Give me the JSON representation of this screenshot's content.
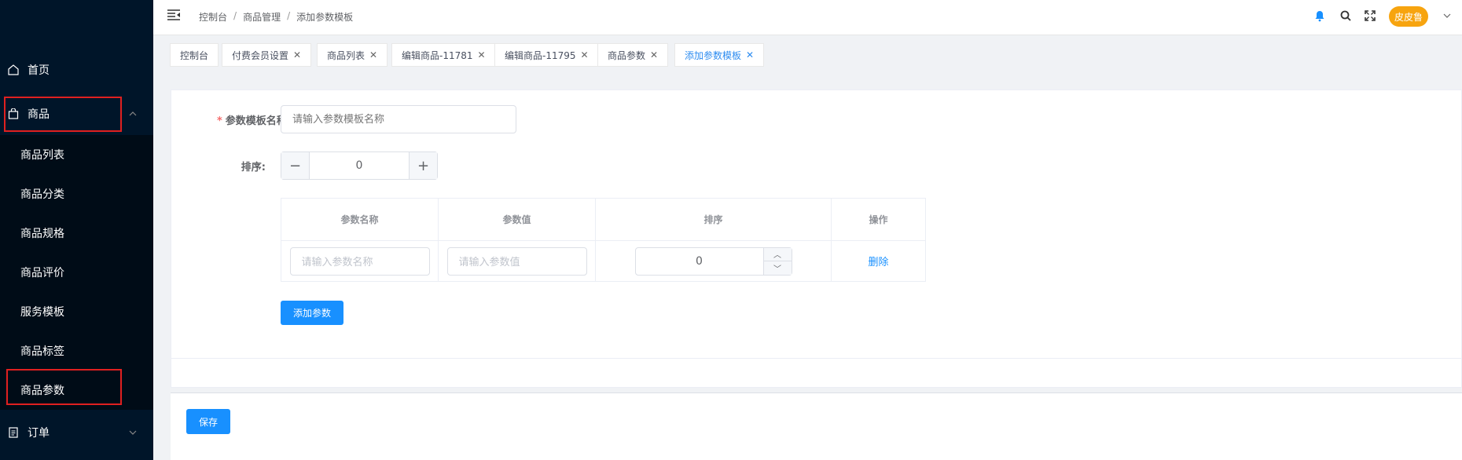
{
  "sidebar": {
    "home": "首页",
    "goods": "商品",
    "orders": "订单",
    "sub_items": [
      "商品列表",
      "商品分类",
      "商品规格",
      "商品评价",
      "服务模板",
      "商品标签",
      "商品参数"
    ]
  },
  "header": {
    "breadcrumb": [
      "控制台",
      "商品管理",
      "添加参数模板"
    ],
    "separator": "/",
    "username": "皮皮鲁"
  },
  "tags": [
    {
      "label": "控制台",
      "closable": false
    },
    {
      "label": "付费会员设置",
      "closable": true
    },
    {
      "label": "商品列表",
      "closable": true
    },
    {
      "label": "编辑商品-11781",
      "closable": true
    },
    {
      "label": "编辑商品-11795",
      "closable": true
    },
    {
      "label": "商品参数",
      "closable": true
    },
    {
      "label": "添加参数模板",
      "closable": true,
      "active": true
    }
  ],
  "form": {
    "name_label": "参数模板名称:",
    "name_required": "*",
    "name_placeholder": "请输入参数模板名称",
    "sort_label": "排序:",
    "sort_value": "0",
    "minus": "−",
    "plus": "+"
  },
  "table": {
    "headers": [
      "参数名称",
      "参数值",
      "排序",
      "操作"
    ],
    "row": {
      "name_placeholder": "请输入参数名称",
      "value_placeholder": "请输入参数值",
      "sort_value": "0",
      "delete_label": "删除"
    }
  },
  "add_param_label": "添加参数",
  "save_label": "保存",
  "colors": {
    "primary": "#1890ff",
    "sidebar": "#001529",
    "avatar": "#f7a40f",
    "highlight": "#e02020"
  }
}
